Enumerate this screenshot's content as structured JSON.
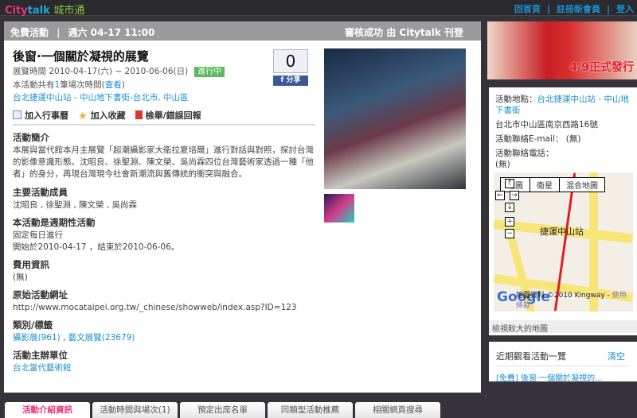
{
  "logo": {
    "city": "City",
    "talk": "talk",
    "zh": "城市通"
  },
  "toplinks": [
    "回首頁",
    "註冊新會員",
    "登入"
  ],
  "header": {
    "type": "免費活動",
    "date": "週六 04-17 11:00",
    "status": "審核成功 由 Citytalk 刊登"
  },
  "event": {
    "title": "後窗·一個關於凝視的展覽",
    "period": "展覽時間 2010-04-17(六) ~ 2010-06-06(日)",
    "badge": "進行中",
    "sessions_pre": "本活動共有",
    "sessions_num": "1",
    "sessions_mid": "筆場次時間(",
    "sessions_link": "查看",
    "sessions_post": ")",
    "location": "台北捷運中山站 - 中山地下書街-台北市, 中山區",
    "share_count": "0",
    "share_label": "分享"
  },
  "actions": [
    "加入行事曆",
    "加入收藏",
    "檢舉/錯誤回報"
  ],
  "sections": [
    {
      "title": "活動簡介",
      "text": "本展與當代館本月主展覽「超潮攝影家大衛拉夏培爾」進行對話與對照，探討台灣的影像意識形態。沈昭良、徐聖淵、陳文榮、吳尚霖四位台灣藝術家透過一種「他者」的身分，再現台灣現今社會新潮流與舊傳統的衝突與融合。"
    },
    {
      "title": "主要活動成員",
      "text": "沈昭良 , 徐聖淵 , 陳文榮 , 吳尚霖"
    },
    {
      "title": "本活動是週期性活動",
      "text": "固定每日進行",
      "text2": "開始於2010-04-17 ，結束於2010-06-06。"
    },
    {
      "title": "費用資訊",
      "text": "(無)"
    },
    {
      "title": "原始活動網址",
      "text": "http://www.mocataipei.org.tw/_chinese/showweb/index.asp?ID=123"
    },
    {
      "title": "類別/標籤",
      "link1": "攝影展(961)",
      "sep": " , ",
      "link2": "藝文展覽(23679)"
    },
    {
      "title": "活動主辦單位",
      "link": "台北當代藝術館"
    }
  ],
  "banner": {
    "text": "4/9正式發行"
  },
  "info": {
    "place_label": "活動地點：",
    "place": "台北捷運中山站 - 中山地下書街",
    "address": "台北市中山區南京西路16號",
    "email": "活動聯絡E-mail： (無)",
    "phone_label": "活動聯絡電話：",
    "phone": "(無)"
  },
  "map": {
    "types": [
      "地圖",
      "衛星",
      "混合地圖"
    ],
    "station": "捷運中山站",
    "google": "Google",
    "copyright": "地圖資料 ©2010 Kingway - ",
    "terms": "使用條款",
    "larger": "檢視較大的地圖"
  },
  "recent": {
    "title": "近期觀看活動一覽",
    "clear": "清空",
    "item": "[免費] 後窗·一個關於凝視的..."
  },
  "tabs": [
    "活動介紹資訊",
    "活動時間與場次(1)",
    "預定出席名單",
    "同類型活動推薦",
    "相關網頁搜尋"
  ]
}
